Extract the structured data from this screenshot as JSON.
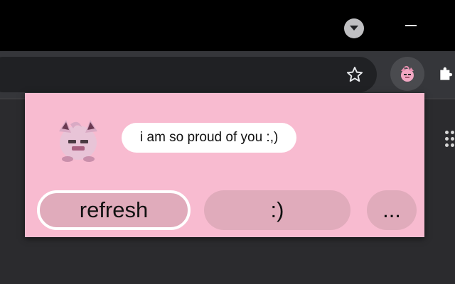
{
  "browser": {
    "colors": {
      "titlebar": "#000000",
      "toolbar": "#35363a",
      "omnibox": "#202124",
      "page": "#2b2b2e"
    },
    "icons": {
      "tab_menu": "chevron-down-icon",
      "minimize": "minimize-icon",
      "bookmark": "star-icon",
      "extension": "jigglypuff-icon",
      "extensions_menu": "puzzle-icon",
      "apps": "apps-grid-icon"
    }
  },
  "popup": {
    "background": "#f8bbd0",
    "button_color": "#e0abbb",
    "mascot_icon": "jigglypuff-icon",
    "message": "i am so proud of you :,)",
    "buttons": {
      "refresh": "refresh",
      "smile": ":)",
      "more": "..."
    }
  }
}
